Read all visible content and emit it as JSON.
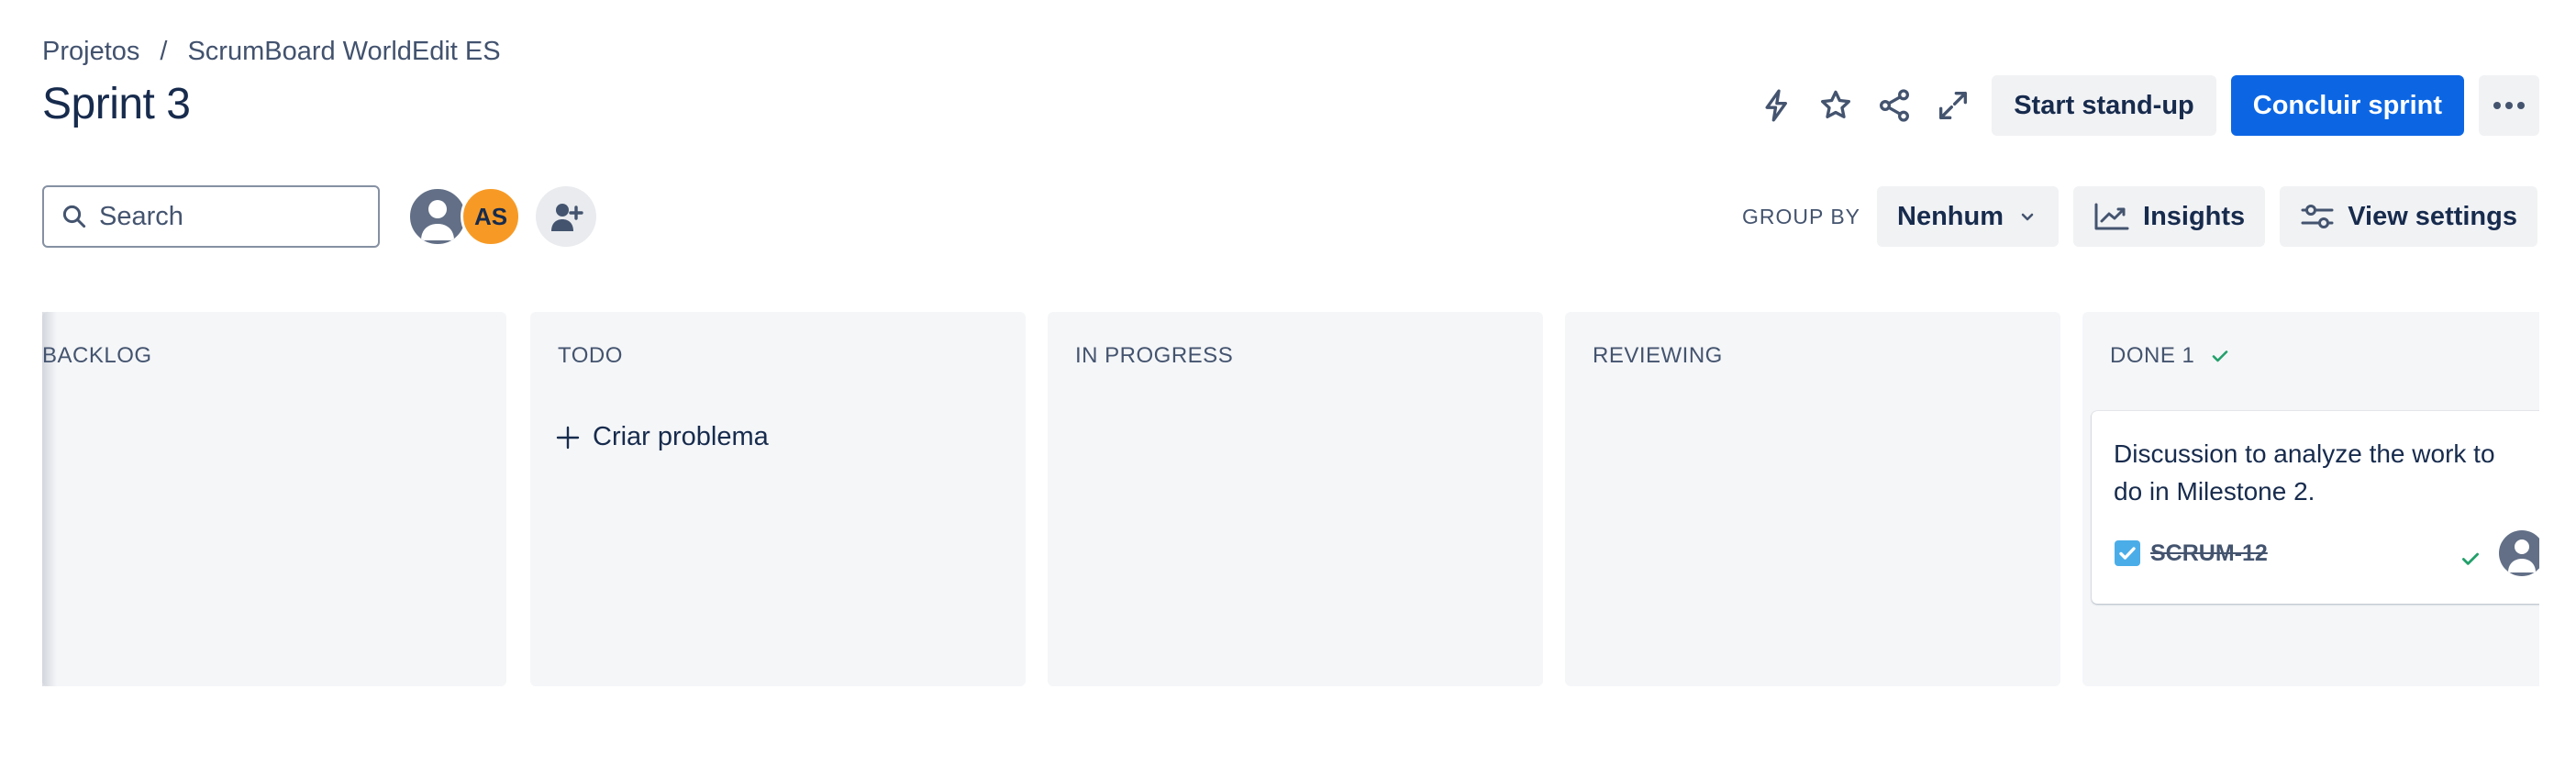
{
  "breadcrumb": {
    "projects": "Projetos",
    "separator": "/",
    "project": "ScrumBoard WorldEdit ES"
  },
  "page": {
    "title": "Sprint 3"
  },
  "actions": {
    "automation_icon": "lightning-icon",
    "star_icon": "star-icon",
    "share_icon": "share-icon",
    "fullscreen_icon": "expand-icon",
    "start_standup": "Start stand-up",
    "complete_sprint": "Concluir sprint",
    "more_icon": "more-icon"
  },
  "search": {
    "placeholder": "Search",
    "value": ""
  },
  "avatars": {
    "second_initials": "AS"
  },
  "toolbar": {
    "group_by_label": "GROUP BY",
    "group_by_value": "Nenhum",
    "insights": "Insights",
    "view_settings": "View settings"
  },
  "columns": [
    {
      "title": "BACKLOG"
    },
    {
      "title": "TODO",
      "create_label": "Criar problema"
    },
    {
      "title": "IN PROGRESS"
    },
    {
      "title": "REVIEWING"
    },
    {
      "title": "DONE 1"
    }
  ],
  "cards": [
    {
      "summary": "Discussion to analyze the work to do in Milestone 2.",
      "key": "SCRUM-12",
      "status": "done"
    }
  ],
  "colors": {
    "primary": "#0c66e4",
    "done_green": "#22a06b",
    "avatar_orange": "#f79a25",
    "column_bg": "#f5f6f8",
    "task_blue": "#4bade8"
  }
}
